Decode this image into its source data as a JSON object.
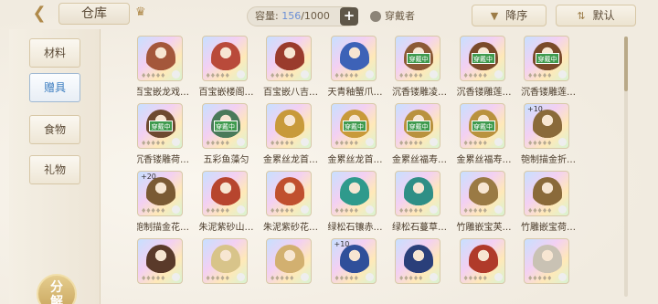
{
  "header": {
    "back_icon": "back-arrow-icon",
    "title": "仓库",
    "crown_icon": "crown-icon",
    "capacity_label": "容量:",
    "capacity_used": "156",
    "capacity_total": "/1000",
    "plus_label": "+",
    "wearer_label": "穿戴者",
    "sort_desc_label": "降序",
    "sort_default_label": "默认",
    "sort_desc_icon": "filter-icon",
    "sort_default_icon": "sort-icon"
  },
  "sidebar": {
    "items": [
      {
        "label": "材料"
      },
      {
        "label": "赠具"
      },
      {
        "label": "食物"
      },
      {
        "label": "礼物"
      }
    ],
    "active_index": 1,
    "decompose_label_top": "分",
    "decompose_label_bottom": "解"
  },
  "items": [
    {
      "name": "百宝嵌龙戏…",
      "equipped": "",
      "level": "",
      "color": "#a4573b"
    },
    {
      "name": "百宝嵌楼阁…",
      "equipped": "",
      "level": "",
      "color": "#b94a3a"
    },
    {
      "name": "百宝嵌八吉…",
      "equipped": "",
      "level": "",
      "color": "#9a3b2c"
    },
    {
      "name": "天青釉蟹爪…",
      "equipped": "",
      "level": "",
      "color": "#3d62b7"
    },
    {
      "name": "沉香镂雕凌…",
      "equipped": "穿戴中",
      "level": "",
      "color": "#8c5a36"
    },
    {
      "name": "沉香镂雕莲…",
      "equipped": "穿戴中",
      "level": "",
      "color": "#7a4a2a"
    },
    {
      "name": "沉香镂雕莲…",
      "equipped": "穿戴中",
      "level": "",
      "color": "#7a4a2a"
    },
    {
      "name": "沉香镂雕荷…",
      "equipped": "穿戴中",
      "level": "",
      "color": "#6e4a30"
    },
    {
      "name": "五彩鱼藻匀",
      "equipped": "穿戴中",
      "level": "",
      "color": "#4a7a5a"
    },
    {
      "name": "金累丝龙首…",
      "equipped": "",
      "level": "",
      "color": "#c89a3a"
    },
    {
      "name": "金累丝龙首…",
      "equipped": "穿戴中",
      "level": "",
      "color": "#c89a3a"
    },
    {
      "name": "金累丝福寿…",
      "equipped": "穿戴中",
      "level": "",
      "color": "#b9923e"
    },
    {
      "name": "金累丝福寿…",
      "equipped": "穿戴中",
      "level": "",
      "color": "#b9923e"
    },
    {
      "name": "匏制描金折…",
      "equipped": "",
      "level": "+10",
      "color": "#8a6a3a"
    },
    {
      "name": "匏制描金花…",
      "equipped": "",
      "level": "+20",
      "color": "#7a5a34"
    },
    {
      "name": "朱泥紫砂山…",
      "equipped": "",
      "level": "",
      "color": "#b7452e"
    },
    {
      "name": "朱泥紫砂花…",
      "equipped": "",
      "level": "",
      "color": "#c0502e"
    },
    {
      "name": "绿松石镶赤…",
      "equipped": "",
      "level": "",
      "color": "#2f9a8c"
    },
    {
      "name": "绿松石蔓草…",
      "equipped": "",
      "level": "",
      "color": "#2f8f86"
    },
    {
      "name": "竹雕嵌宝芙…",
      "equipped": "",
      "level": "",
      "color": "#9a7a44"
    },
    {
      "name": "竹雕嵌宝荷…",
      "equipped": "",
      "level": "",
      "color": "#8a6a3a"
    },
    {
      "name": "",
      "equipped": "",
      "level": "",
      "color": "#5a3a2a"
    },
    {
      "name": "",
      "equipped": "",
      "level": "",
      "color": "#d8c48a"
    },
    {
      "name": "",
      "equipped": "",
      "level": "",
      "color": "#d2b070"
    },
    {
      "name": "",
      "equipped": "",
      "level": "+10",
      "color": "#2f4f9a"
    },
    {
      "name": "",
      "equipped": "",
      "level": "",
      "color": "#2a3f7a"
    },
    {
      "name": "",
      "equipped": "",
      "level": "",
      "color": "#b03a2a"
    },
    {
      "name": "",
      "equipped": "",
      "level": "",
      "color": "#c9c2b4"
    }
  ],
  "stars": "♦♦♦♦♦"
}
